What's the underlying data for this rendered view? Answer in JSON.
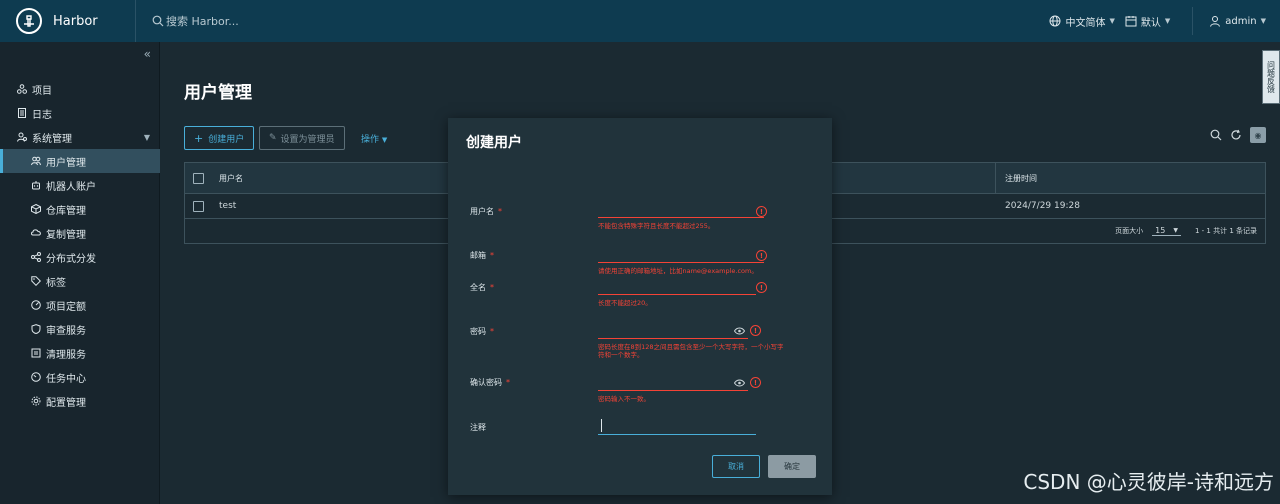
{
  "header": {
    "brand": "Harbor",
    "search_placeholder": "搜索 Harbor...",
    "language": "中文简体",
    "calendar": "默认",
    "user": "admin"
  },
  "sidebar": {
    "collapse_glyph": "«",
    "items": [
      {
        "label": "项目",
        "icon": "projects-icon"
      },
      {
        "label": "日志",
        "icon": "logs-icon"
      },
      {
        "label": "系统管理",
        "icon": "admin-icon"
      }
    ],
    "sub_items": [
      {
        "label": "用户管理",
        "icon": "users-icon",
        "active": true
      },
      {
        "label": "机器人账户",
        "icon": "robot-icon"
      },
      {
        "label": "仓库管理",
        "icon": "registry-icon"
      },
      {
        "label": "复制管理",
        "icon": "replication-icon"
      },
      {
        "label": "分布式分发",
        "icon": "distribution-icon"
      },
      {
        "label": "标签",
        "icon": "tag-icon"
      },
      {
        "label": "项目定额",
        "icon": "quota-icon"
      },
      {
        "label": "审查服务",
        "icon": "shield-icon"
      },
      {
        "label": "清理服务",
        "icon": "clean-icon"
      },
      {
        "label": "任务中心",
        "icon": "dashboard-icon"
      },
      {
        "label": "配置管理",
        "icon": "gear-icon"
      }
    ]
  },
  "main": {
    "title": "用户管理",
    "create_user": "创建用户",
    "set_admin": "设置为管理员",
    "actions": "操作",
    "table": {
      "col_username": "用户名",
      "col_created": "注册时间",
      "rows": [
        {
          "username": "test",
          "created": "2024/7/29 19:28"
        }
      ],
      "page_size_label": "页面大小",
      "page_size": "15",
      "summary": "1 - 1 共计 1 条记录"
    }
  },
  "feedback": "问题反馈",
  "modal": {
    "title": "创建用户",
    "fields": [
      {
        "label": "用户名",
        "error": "不能包含特殊字符且长度不能超过255。"
      },
      {
        "label": "邮箱",
        "error": "请使用正确的邮箱地址，比如name@example.com。"
      },
      {
        "label": "全名",
        "error": "长度不能超过20。"
      },
      {
        "label": "密码",
        "error_line1": "密码长度在8到128之间且需包含至少一个大写字符，一个小写字",
        "error_line2": "符和一个数字。"
      },
      {
        "label": "确认密码",
        "error": "密码输入不一致。"
      },
      {
        "label": "注释"
      }
    ],
    "required_mark": "*",
    "cancel": "取消",
    "ok": "确定"
  },
  "watermark": "CSDN @心灵彼岸-诗和远方",
  "colors": {
    "accent": "#49afd9",
    "error": "#f44336",
    "header": "#0e3b50"
  }
}
